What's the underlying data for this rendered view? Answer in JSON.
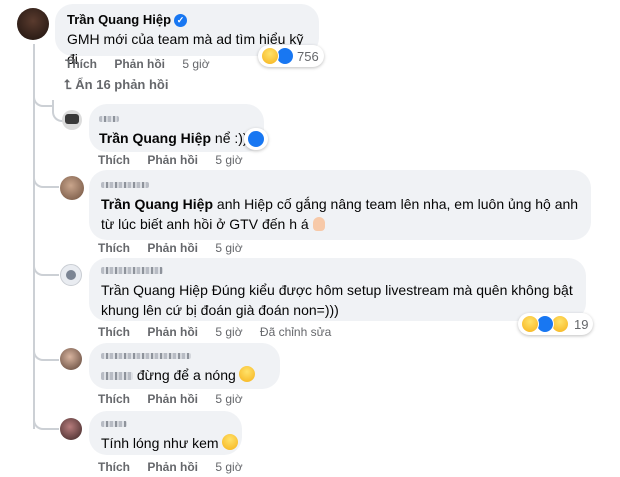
{
  "colors": {
    "bubble": "#f0f2f5",
    "meta": "#65676b",
    "like_blue": "#1877f2"
  },
  "main_comment": {
    "author": "Trần Quang Hiệp",
    "text": "GMH mới của team mà ad tìm hiểu kỹ đi",
    "reaction_count": "756",
    "actions": {
      "like": "Thích",
      "reply": "Phản hồi",
      "time": "5 giờ"
    }
  },
  "replies_toggle": "Ẩn 16 phản hồi",
  "replies": [
    {
      "mention": "Trần Quang Hiệp",
      "text": " nể :))",
      "actions": {
        "like": "Thích",
        "reply": "Phản hồi",
        "time": "5 giờ"
      }
    },
    {
      "mention": "Trần Quang Hiệp",
      "line1": " anh Hiệp cố gắng nâng team lên nha, em luôn ủng hộ anh",
      "line2": "từ lúc biết anh hồi ở GTV đến h á",
      "actions": {
        "like": "Thích",
        "reply": "Phản hồi",
        "time": "5 giờ"
      }
    },
    {
      "mention": "Trần Quang Hiệp",
      "line1": " Đúng kiểu được hôm setup livestream mà quên không bật",
      "line2": "khung lên cứ bị đoán già đoán non=)))",
      "reaction_count": "19",
      "actions": {
        "like": "Thích",
        "reply": "Phản hồi",
        "time": "5 giờ",
        "edited": "Đã chỉnh sửa"
      }
    },
    {
      "text": " đừng để a nóng",
      "actions": {
        "like": "Thích",
        "reply": "Phản hồi",
        "time": "5 giờ"
      }
    },
    {
      "text": "Tính lóng như kem",
      "actions": {
        "like": "Thích",
        "reply": "Phản hồi",
        "time": "5 giờ"
      }
    }
  ],
  "icons": {
    "verified": "verified-badge-icon",
    "toggle": "reply-arrow-icon",
    "reactions": [
      "haha-icon",
      "like-icon",
      "sad-icon"
    ]
  }
}
